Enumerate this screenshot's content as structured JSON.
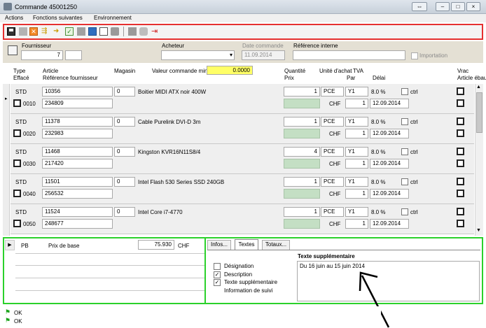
{
  "window": {
    "title": "Commande 45001250"
  },
  "menu": [
    "Actions",
    "Fonctions suivantes",
    "Environnement"
  ],
  "header": {
    "fournisseur_label": "Fournisseur",
    "fournisseur_value": "7",
    "acheteur_label": "Acheteur",
    "date_commande_label": "Date commande",
    "date_commande_value": "11.09.2014",
    "reference_label": "Référence interne",
    "importation_label": "Importation"
  },
  "grid_headers": {
    "type": "Type",
    "efface": "Effacé",
    "article": "Article",
    "ref_fournisseur": "Référence fournisseur",
    "magasin": "Magasin",
    "valeur_label": "Valeur commande min",
    "valeur_value": "0.0000",
    "quantite": "Quantité",
    "prix": "Prix",
    "unite": "Unité d'achat",
    "tva": "TVA",
    "par": "Par",
    "delai": "Délai",
    "vrac": "Vrac",
    "article_ebauche": "Article ébauche"
  },
  "rows": [
    {
      "type": "STD",
      "pos": "0010",
      "article": "10356",
      "ref": "234809",
      "magasin": "0",
      "designation": "Boitier MIDI ATX noir 400W",
      "qty": "1",
      "unit": "PCE",
      "tva": "Y1",
      "tva_pct": "8.0 %",
      "ctrl": "ctrl",
      "currency": "CHF",
      "par": "1",
      "date": "12.09.2014"
    },
    {
      "type": "STD",
      "pos": "0020",
      "article": "11378",
      "ref": "232983",
      "magasin": "0",
      "designation": "Cable Purelink DVI-D 3m",
      "qty": "1",
      "unit": "PCE",
      "tva": "Y1",
      "tva_pct": "8.0 %",
      "ctrl": "ctrl",
      "currency": "CHF",
      "par": "1",
      "date": "12.09.2014"
    },
    {
      "type": "STD",
      "pos": "0030",
      "article": "11468",
      "ref": "217420",
      "magasin": "0",
      "designation": "Kingston KVR16N11S8/4",
      "qty": "4",
      "unit": "PCE",
      "tva": "Y1",
      "tva_pct": "8.0 %",
      "ctrl": "ctrl",
      "currency": "CHF",
      "par": "1",
      "date": "12.09.2014"
    },
    {
      "type": "STD",
      "pos": "0040",
      "article": "11501",
      "ref": "256532",
      "magasin": "0",
      "designation": "Intel Flash 530 Series SSD 240GB",
      "qty": "1",
      "unit": "PCE",
      "tva": "Y1",
      "tva_pct": "8.0 %",
      "ctrl": "ctrl",
      "currency": "CHF",
      "par": "1",
      "date": "12.09.2014"
    },
    {
      "type": "STD",
      "pos": "0050",
      "article": "11524",
      "ref": "248677",
      "magasin": "0",
      "designation": "Intel Core i7-4770",
      "qty": "1",
      "unit": "PCE",
      "tva": "Y1",
      "tva_pct": "8.0 %",
      "ctrl": "ctrl",
      "currency": "CHF",
      "par": "1",
      "date": "12.09.2014"
    }
  ],
  "price_panel": {
    "code": "PB",
    "label": "Prix de base",
    "value": "75.930",
    "currency": "CHF"
  },
  "tabs": {
    "infos": "Infos...",
    "textes": "Textes",
    "totaux": "Totaux..."
  },
  "textes": {
    "designation": "Désignation",
    "description": "Description",
    "texte_sup": "Texte supplémentaire",
    "info_suivi": "Information de suivi",
    "title": "Texte supplémentaire",
    "content": "Du 16 juin au 15 juin 2014"
  },
  "status": [
    "OK",
    "OK"
  ],
  "colors": {
    "accent_red": "#e53030",
    "accent_green": "#2bd12b",
    "valeur_bg": "#ffff66",
    "price_bg": "#c4dfc4"
  }
}
